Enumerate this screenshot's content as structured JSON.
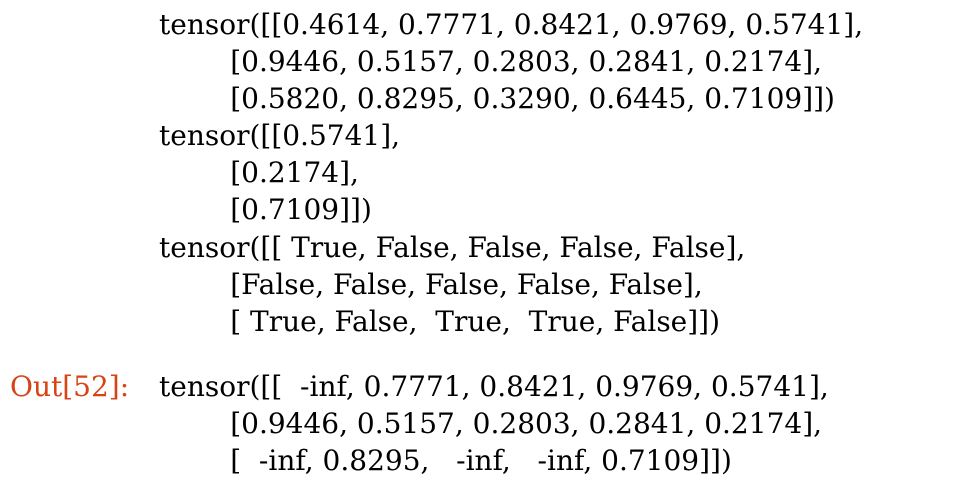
{
  "colors": {
    "text": "#000000",
    "out_prompt": "#d84315",
    "background": "#ffffff"
  },
  "stream_output": {
    "lines": [
      "tensor([[0.4614, 0.7771, 0.8421, 0.9769, 0.5741],",
      "        [0.9446, 0.5157, 0.2803, 0.2841, 0.2174],",
      "        [0.5820, 0.8295, 0.3290, 0.6445, 0.7109]])",
      "tensor([[0.5741],",
      "        [0.2174],",
      "        [0.7109]])",
      "tensor([[ True, False, False, False, False],",
      "        [False, False, False, False, False],",
      "        [ True, False,  True,  True, False]])"
    ]
  },
  "result_output": {
    "prompt": "Out[52]:",
    "lines": [
      "tensor([[  -inf, 0.7771, 0.8421, 0.9769, 0.5741],",
      "        [0.9446, 0.5157, 0.2803, 0.2841, 0.2174],",
      "        [  -inf, 0.8295,   -inf,   -inf, 0.7109]])"
    ]
  }
}
